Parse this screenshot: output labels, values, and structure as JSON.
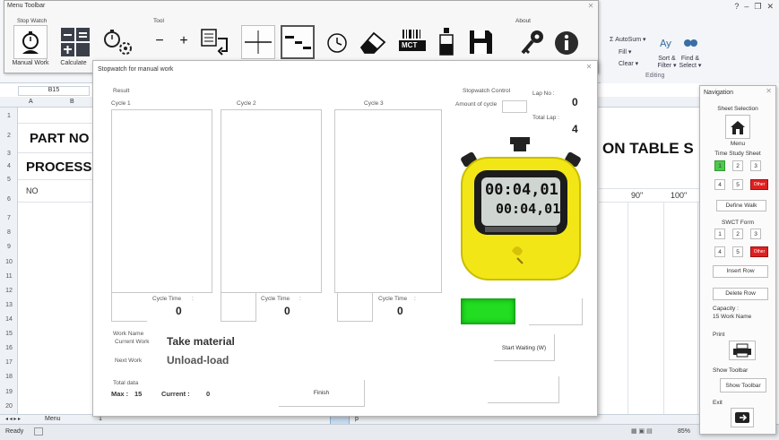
{
  "excel": {
    "ribbon": {
      "autosum": "Σ AutoSum ▾",
      "fill": "Fill ▾",
      "clear": "Clear ▾",
      "sort_filter": "Sort & Filter ▾",
      "find_select": "Find & Select ▾",
      "group_editing": "Editing"
    },
    "name_box": "B15",
    "columns": [
      "A",
      "B"
    ],
    "rows": [
      "1",
      "2",
      "3",
      "4",
      "5",
      "6",
      "7",
      "8",
      "9",
      "10",
      "11",
      "12",
      "13",
      "14",
      "15",
      "16",
      "17",
      "18",
      "19",
      "20",
      "21"
    ],
    "cells": {
      "part_no": "PART NO",
      "process": "PROCESS",
      "no": "NO",
      "table_title": "ON TABLE S",
      "pct_90": "90\"",
      "pct_100": "100\""
    },
    "sheet_tab": "Menu",
    "sheet_tab_marker": "1",
    "sheet_tab_right": "p",
    "status": {
      "ready": "Ready",
      "zoom": "85%"
    }
  },
  "toolbar": {
    "title": "Menu Toolbar",
    "groups": {
      "stopwatch": "Stop Watch",
      "tool": "Tool",
      "about": "About"
    },
    "buttons": [
      {
        "id": "manual-work",
        "label": "Manual Work"
      },
      {
        "id": "calculate",
        "label": "Calculate"
      },
      {
        "id": "stopwatch-settings",
        "label": ""
      },
      {
        "id": "minus",
        "label": ""
      },
      {
        "id": "plus",
        "label": ""
      },
      {
        "id": "list",
        "label": ""
      },
      {
        "id": "hline",
        "label": ""
      },
      {
        "id": "steps",
        "label": ""
      },
      {
        "id": "clock",
        "label": ""
      },
      {
        "id": "eraser",
        "label": ""
      },
      {
        "id": "mct",
        "label": ""
      },
      {
        "id": "bottle",
        "label": ""
      },
      {
        "id": "save",
        "label": ""
      },
      {
        "id": "key",
        "label": ""
      },
      {
        "id": "info",
        "label": ""
      }
    ],
    "mct_text": "MCT"
  },
  "dialog": {
    "title": "Stopwatch for manual work",
    "result": "Result",
    "cycles": [
      {
        "label": "Cycle 1",
        "time_label": "Cycle Time",
        "colon": ":",
        "value": "0"
      },
      {
        "label": "Cycle 2",
        "time_label": "Cycle Time",
        "colon": ":",
        "value": "0"
      },
      {
        "label": "Cycle 3",
        "time_label": "Cycle Time",
        "colon": ":",
        "value": "0"
      }
    ],
    "stopwatch_control": "Stopwatch Control",
    "amount_of_cycle": "Amount of cycle",
    "lap_no_label": "Lap No :",
    "lap_no": "0",
    "total_lap_label": "Total Lap :",
    "total_lap": "4",
    "display_main": "00:04,01",
    "display_sub": "00:04,01",
    "work_name": "Work Name",
    "current_work_label": "Current Work",
    "current_work": "Take material",
    "next_work_label": "Next Work",
    "next_work": "Unload-load",
    "total_data": "Total data",
    "max_label": "Max :",
    "max_value": "15",
    "current_label": "Current :",
    "current_value": "0",
    "finish": "Finish",
    "start_waiting": "Start Waiting (W)"
  },
  "navigation": {
    "title": "Navigation",
    "sheet_selection": "Sheet Selection",
    "menu": "Menu",
    "time_study_sheet": "Time Study Sheet",
    "ts_numbers": [
      "1",
      "2",
      "3",
      "4",
      "5"
    ],
    "ts_other": "Other",
    "define_walk": "Define Walk",
    "swct_form": "SWCT Form",
    "sw_numbers": [
      "1",
      "2",
      "3",
      "4",
      "5"
    ],
    "sw_other": "Other",
    "insert_row": "Insert Row",
    "delete_row": "Delete Row",
    "capacity_label": "Capacity :",
    "capacity_value": "15 Work Name",
    "print": "Print",
    "show_toolbar_label": "Show Toolbar",
    "show_toolbar_btn": "Show Toolbar",
    "exit": "Exit"
  },
  "colors": {
    "stopwatch_body": "#f2e617",
    "green_button": "#22dd22",
    "other_red": "#e02020"
  }
}
